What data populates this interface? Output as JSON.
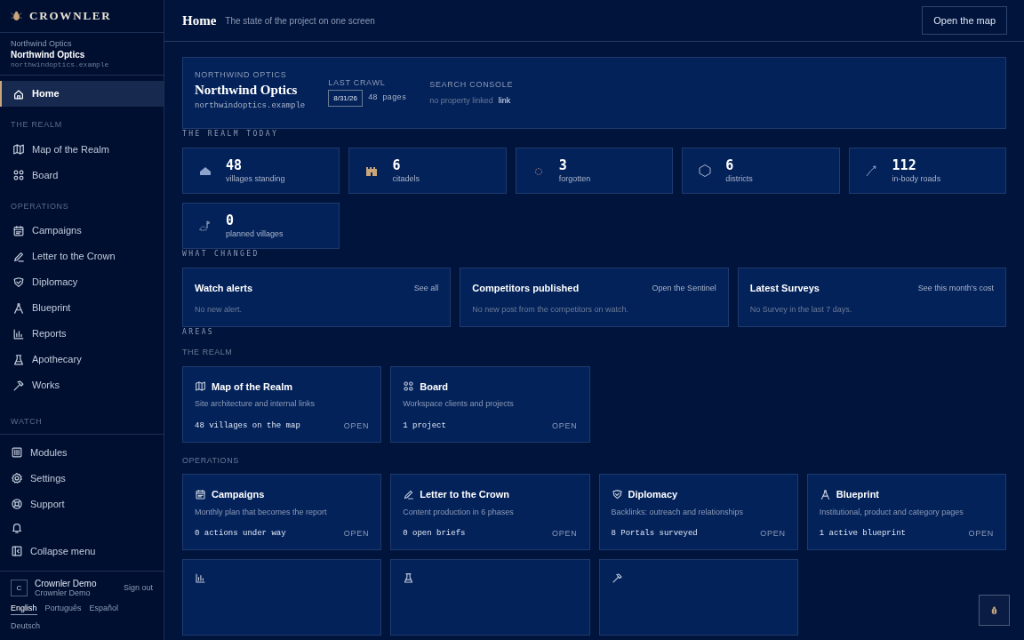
{
  "brand": "CROWNLER",
  "project": {
    "workspace": "Northwind Optics",
    "name": "Northwind Optics",
    "domain": "northwindoptics.example"
  },
  "sidebar": {
    "sections": [
      {
        "items": [
          {
            "label": "Home",
            "selected": true
          }
        ]
      },
      {
        "title": "THE REALM",
        "items": [
          {
            "label": "Map of the Realm",
            "selected": false
          },
          {
            "label": "Board",
            "selected": false
          }
        ]
      },
      {
        "title": "OPERATIONS",
        "items": [
          {
            "label": "Campaigns",
            "selected": false
          },
          {
            "label": "Letter to the Crown",
            "selected": false
          },
          {
            "label": "Diplomacy",
            "selected": false
          },
          {
            "label": "Blueprint",
            "selected": false
          },
          {
            "label": "Reports",
            "selected": false
          },
          {
            "label": "Apothecary",
            "selected": false
          },
          {
            "label": "Works",
            "selected": false
          }
        ]
      }
    ],
    "watch_heading": "WATCH",
    "footer_items": [
      {
        "kind": "link",
        "label": "Modules"
      },
      {
        "kind": "link",
        "label": "Settings"
      },
      {
        "kind": "link",
        "label": "Support"
      },
      {
        "kind": "bell"
      },
      {
        "kind": "link",
        "label": "Collapse menu"
      }
    ],
    "user": {
      "initial": "C",
      "name": "Crownler Demo",
      "org": "Crownler Demo",
      "sign_out": "Sign out"
    },
    "languages": [
      {
        "label": "English",
        "selected": true
      },
      {
        "label": "Português",
        "selected": false
      },
      {
        "label": "Español",
        "selected": false
      },
      {
        "label": "Deutsch",
        "selected": false
      }
    ]
  },
  "header": {
    "title": "Home",
    "subtitle": "The state of the project on one screen",
    "action": "Open the map"
  },
  "overview": {
    "eyebrow": "NORTHWIND OPTICS",
    "name": "Northwind Optics",
    "domain": "northwindoptics.example",
    "last_crawl_label": "LAST CRAWL",
    "last_crawl_date": "8/31/26",
    "last_crawl_pages": "48 pages",
    "console_label": "SEARCH CONSOLE",
    "console_status": "no property linked",
    "console_link": "link"
  },
  "realm_today": {
    "title": "THE REALM TODAY",
    "stats": [
      {
        "value": "48",
        "label": "villages standing"
      },
      {
        "value": "6",
        "label": "citadels"
      },
      {
        "value": "3",
        "label": "forgotten"
      },
      {
        "value": "6",
        "label": "districts"
      },
      {
        "value": "112",
        "label": "in-body roads"
      },
      {
        "value": "0",
        "label": "planned villages"
      }
    ]
  },
  "what_changed": {
    "title": "WHAT CHANGED",
    "cards": [
      {
        "title": "Watch alerts",
        "link": "See all",
        "body": "No new alert."
      },
      {
        "title": "Competitors published",
        "link": "Open the Sentinel",
        "body": "No new post from the competitors on watch."
      },
      {
        "title": "Latest Surveys",
        "link": "See this month's cost",
        "body": "No Survey in the last 7 days."
      }
    ]
  },
  "areas": {
    "title": "AREAS",
    "groups": [
      {
        "title": "THE REALM",
        "cards": [
          {
            "kind": "card",
            "title": "Map of the Realm",
            "description": "Site architecture and internal links",
            "count": "48 villages on the map",
            "action": "OPEN"
          },
          {
            "kind": "card",
            "title": "Board",
            "description": "Workspace clients and projects",
            "count": "1 project",
            "action": "OPEN"
          }
        ]
      },
      {
        "title": "OPERATIONS",
        "cards": [
          {
            "kind": "card",
            "title": "Campaigns",
            "description": "Monthly plan that becomes the report",
            "count": "0 actions under way",
            "action": "OPEN"
          },
          {
            "kind": "card",
            "title": "Letter to the Crown",
            "description": "Content production in 6 phases",
            "count": "0 open briefs",
            "action": "OPEN"
          },
          {
            "kind": "card",
            "title": "Diplomacy",
            "description": "Backlinks: outreach and relationships",
            "count": "8 Portals surveyed",
            "action": "OPEN"
          },
          {
            "kind": "card",
            "title": "Blueprint",
            "description": "Institutional, product and category pages",
            "count": "1 active blueprint",
            "action": "OPEN"
          },
          {
            "kind": "cut"
          },
          {
            "kind": "cut"
          },
          {
            "kind": "cut"
          }
        ]
      }
    ]
  }
}
